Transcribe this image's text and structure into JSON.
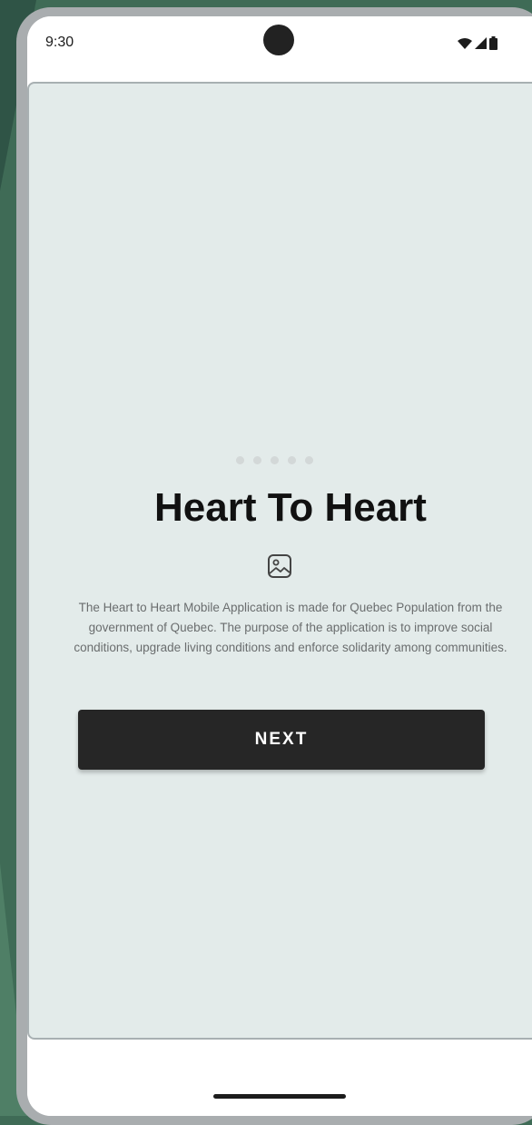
{
  "status_bar": {
    "time": "9:30",
    "icons": [
      "wifi-icon",
      "cell-signal-icon",
      "battery-icon"
    ]
  },
  "onboarding": {
    "page_indicator": {
      "count": 5
    },
    "title": "Heart To Heart",
    "image_icon": "image-placeholder-icon",
    "description": "The Heart to Heart Mobile Application is made for Quebec Population from the government of Quebec. The purpose of the application is to improve social conditions, upgrade living conditions and enforce solidarity among communities.",
    "next_label": "NEXT"
  },
  "colors": {
    "background": "#e3ebea",
    "button": "#262626",
    "button_text": "#ffffff",
    "title": "#111111",
    "description": "#6a6d6e",
    "desktop": "#3f6b56"
  }
}
